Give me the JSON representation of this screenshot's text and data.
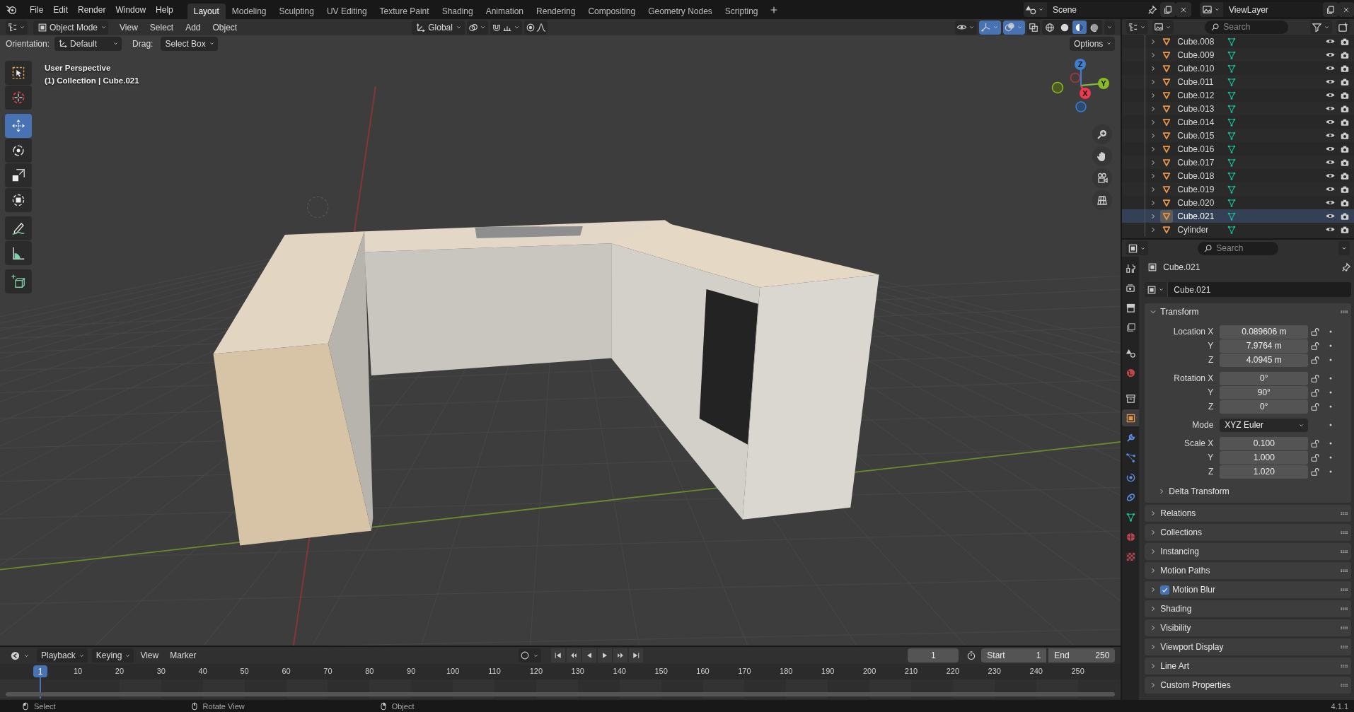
{
  "top_bar": {
    "menus": [
      "File",
      "Edit",
      "Render",
      "Window",
      "Help"
    ],
    "workspaces": [
      {
        "label": "Layout",
        "selected": true
      },
      {
        "label": "Modeling",
        "selected": false
      },
      {
        "label": "Sculpting",
        "selected": false
      },
      {
        "label": "UV Editing",
        "selected": false
      },
      {
        "label": "Texture Paint",
        "selected": false
      },
      {
        "label": "Shading",
        "selected": false
      },
      {
        "label": "Animation",
        "selected": false
      },
      {
        "label": "Rendering",
        "selected": false
      },
      {
        "label": "Compositing",
        "selected": false
      },
      {
        "label": "Geometry Nodes",
        "selected": false
      },
      {
        "label": "Scripting",
        "selected": false
      }
    ],
    "scene": "Scene",
    "view_layer": "ViewLayer"
  },
  "viewport": {
    "mode": "Object Mode",
    "menus": [
      "View",
      "Select",
      "Add",
      "Object"
    ],
    "transform_orientation": "Global",
    "shading_modes": [
      {
        "kind": "wireframe",
        "selected": false
      },
      {
        "kind": "solid",
        "selected": false
      },
      {
        "kind": "material",
        "selected": true
      },
      {
        "kind": "rendered",
        "selected": false
      }
    ],
    "orientation_label": "Orientation:",
    "orientation": "Default",
    "drag_label": "Drag:",
    "drag": "Select Box",
    "options": "Options",
    "info": [
      "User Perspective",
      "(1) Collection | Cube.021"
    ],
    "tool_groups": [
      [
        {
          "kind": "select-box",
          "selected": false
        },
        {
          "kind": "cursor",
          "selected": false
        }
      ],
      [
        {
          "kind": "move",
          "selected": true
        },
        {
          "kind": "rotate",
          "selected": false
        },
        {
          "kind": "scale",
          "selected": false
        },
        {
          "kind": "transform",
          "selected": false
        }
      ],
      [
        {
          "kind": "annotate",
          "selected": false
        },
        {
          "kind": "measure",
          "selected": false
        }
      ],
      [
        {
          "kind": "add-cube",
          "selected": false
        }
      ]
    ],
    "gizmo_axes": [
      "Z",
      "Y",
      "X"
    ]
  },
  "outliner": {
    "search": {
      "placeholder": "Search"
    },
    "items": [
      {
        "name": "Cube.008",
        "selected": false
      },
      {
        "name": "Cube.009",
        "selected": false
      },
      {
        "name": "Cube.010",
        "selected": false
      },
      {
        "name": "Cube.011",
        "selected": false
      },
      {
        "name": "Cube.012",
        "selected": false
      },
      {
        "name": "Cube.013",
        "selected": false
      },
      {
        "name": "Cube.014",
        "selected": false
      },
      {
        "name": "Cube.015",
        "selected": false
      },
      {
        "name": "Cube.016",
        "selected": false
      },
      {
        "name": "Cube.017",
        "selected": false
      },
      {
        "name": "Cube.018",
        "selected": false
      },
      {
        "name": "Cube.019",
        "selected": false
      },
      {
        "name": "Cube.020",
        "selected": false
      },
      {
        "name": "Cube.021",
        "selected": true
      },
      {
        "name": "Cylinder",
        "selected": false
      }
    ]
  },
  "properties": {
    "search": {
      "placeholder": "Search"
    },
    "tabs": [
      {
        "kind": "tool",
        "selected": false
      },
      {
        "kind": "render",
        "selected": false
      },
      {
        "kind": "output",
        "selected": false
      },
      {
        "kind": "view-layer",
        "selected": false
      },
      {
        "kind": "scene",
        "selected": false
      },
      {
        "kind": "world",
        "selected": false
      },
      {
        "kind": "collection",
        "selected": false
      },
      {
        "kind": "object",
        "selected": true
      },
      {
        "kind": "modifiers",
        "selected": false
      },
      {
        "kind": "particles",
        "selected": false
      },
      {
        "kind": "physics",
        "selected": false
      },
      {
        "kind": "constraints",
        "selected": false
      },
      {
        "kind": "data",
        "selected": false
      },
      {
        "kind": "material",
        "selected": false
      },
      {
        "kind": "texture",
        "selected": false
      }
    ],
    "object_name": "Cube.021",
    "datablock": "Cube.021",
    "transform": {
      "title": "Transform",
      "expanded": true,
      "groups": [
        [
          {
            "kind": "number",
            "label": "Location X",
            "value": "0.089606 m"
          },
          {
            "kind": "number",
            "label": "Y",
            "value": "7.9764 m"
          },
          {
            "kind": "number",
            "label": "Z",
            "value": "4.0945 m"
          }
        ],
        [
          {
            "kind": "number",
            "label": "Rotation X",
            "value": "0°"
          },
          {
            "kind": "number",
            "label": "Y",
            "value": "90°"
          },
          {
            "kind": "number",
            "label": "Z",
            "value": "0°"
          }
        ],
        [
          {
            "kind": "dropdown",
            "label": "Mode",
            "value": "XYZ Euler"
          }
        ],
        [
          {
            "kind": "number",
            "label": "Scale X",
            "value": "0.100"
          },
          {
            "kind": "number",
            "label": "Y",
            "value": "1.000"
          },
          {
            "kind": "number",
            "label": "Z",
            "value": "1.020"
          }
        ]
      ],
      "subpanel": {
        "title": "Delta Transform",
        "expanded": false
      }
    },
    "panels": [
      {
        "kind": "plain",
        "title": "Relations",
        "expanded": false
      },
      {
        "kind": "plain",
        "title": "Collections",
        "expanded": false
      },
      {
        "kind": "plain",
        "title": "Instancing",
        "expanded": false
      },
      {
        "kind": "plain",
        "title": "Motion Paths",
        "expanded": false
      },
      {
        "kind": "checkbox",
        "title": "Motion Blur",
        "expanded": false,
        "checked": true
      },
      {
        "kind": "plain",
        "title": "Shading",
        "expanded": false
      },
      {
        "kind": "plain",
        "title": "Visibility",
        "expanded": false
      },
      {
        "kind": "plain",
        "title": "Viewport Display",
        "expanded": false
      },
      {
        "kind": "plain",
        "title": "Line Art",
        "expanded": false
      },
      {
        "kind": "plain",
        "title": "Custom Properties",
        "expanded": false
      }
    ]
  },
  "timeline": {
    "dropdowns": [
      "Playback",
      "Keying"
    ],
    "menus": [
      "View",
      "Marker"
    ],
    "current_frame": "1",
    "start_label": "Start",
    "start": "1",
    "end_label": "End",
    "end": "250",
    "playhead": "1",
    "ruler": [
      "10",
      "20",
      "30",
      "40",
      "50",
      "60",
      "70",
      "80",
      "90",
      "100",
      "110",
      "120",
      "130",
      "140",
      "150",
      "160",
      "170",
      "180",
      "190",
      "200",
      "210",
      "220",
      "230",
      "240",
      "250"
    ]
  },
  "status_bar": {
    "hints": [
      {
        "kind": "left-click",
        "label": "Select"
      },
      {
        "kind": "middle-click",
        "label": "Rotate View"
      },
      {
        "kind": "right-click",
        "label": "Object"
      }
    ],
    "version": "4.1.1"
  }
}
